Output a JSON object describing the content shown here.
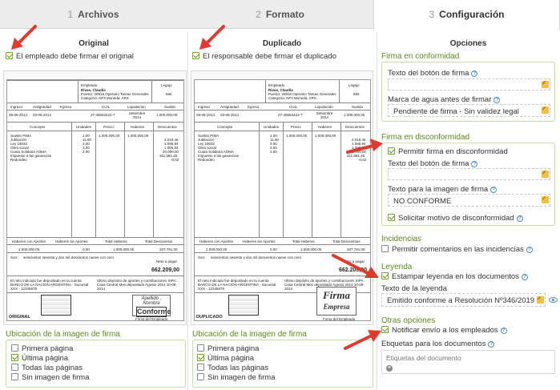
{
  "tabs": [
    {
      "num": "1",
      "label": "Archivos"
    },
    {
      "num": "2",
      "label": "Formato"
    },
    {
      "num": "3",
      "label": "Configuración"
    }
  ],
  "original": {
    "title": "Original",
    "check_label": "El empleado debe firmar el original",
    "check_on": true,
    "receipt": {
      "label": "ORIGINAL",
      "stamp_label": "Firma del Empleado",
      "sign_text": "Conforme",
      "sign_script": "Apellido , Nombre"
    }
  },
  "duplicado": {
    "title": "Duplicado",
    "check_label": "El responsable debe firmar el duplicado",
    "check_on": true,
    "receipt": {
      "label": "DUPLICADO",
      "stamp_label": "Firma del Empleado",
      "sign_text": "Firma",
      "sign_script": "Empresa"
    }
  },
  "receipt_common": {
    "empleado_label": "Empleado",
    "legajo_label": "Legajo",
    "emp_name": "Rivas, Claudia",
    "emp_line2": "Puesto: 26918 Operario Tareas Generales",
    "emp_line3": "Categoría: NF3 Moneda: ARS",
    "legajo_val": "666",
    "headers": [
      "Ingreso",
      "Antigüedad",
      "Egreso",
      "CUIL",
      "Liquidación",
      "Sueldo"
    ],
    "values": [
      "05-08-2014",
      "03-08-2014",
      "",
      "27-46653422-7",
      "Setiembre 2014",
      "1.000.000,00"
    ],
    "concept_headers": [
      "Concepto",
      "Unidades",
      "Precio",
      "Haberes",
      "Descuentos"
    ],
    "concepts": [
      [
        "Sueldo PIMA",
        "1.00",
        "1.000.000,00",
        "1.000.000,00",
        ""
      ],
      [
        "Jubilación",
        "11.00",
        "",
        "",
        "4.018,46"
      ],
      [
        "Ley 19032",
        "3.00",
        "",
        "",
        "1.095,94"
      ],
      [
        "Obra social",
        "3.00",
        "",
        "",
        "1.095,94"
      ],
      [
        "Cuota Solidaria AOMA",
        "2.00",
        "",
        "",
        "20.000,00"
      ],
      [
        "Impuesto a las ganancias",
        "",
        "",
        "",
        "311.581,45"
      ],
      [
        "Redondeo",
        "",
        "",
        "",
        "-0,62"
      ]
    ],
    "totals_headers": [
      "Haberes con Aportes",
      "Haberes sin Aportes",
      "Total Haberes",
      "Total Descuentos"
    ],
    "totals_values": [
      "1.000.000,00",
      "0,00",
      "1.000.000,00",
      "337.791,00"
    ],
    "son_label": "Son:",
    "son_text": "seiscientos sesenta y dos mil doscientos nueve con cero",
    "neto_label": "Neto a pagar",
    "neto_value": "662.209,00",
    "deposit_text": "El neto indicado fue depositado en la cuenta BANCO DE LA NACION ARGENTINA - Sucursal XXX - 12345678",
    "aportes_text": "Último depósito de aportes y contribuciones SIPA: Casa Central Mes depositado Agosto 2014 10-09-2014"
  },
  "ubicacion": {
    "title": "Ubicación de la imagen de firma",
    "options": [
      "Primera página",
      "Última página",
      "Todas las páginas",
      "Sin imagen de firma"
    ],
    "left_selected": 1,
    "right_selected": 1
  },
  "opciones": {
    "title": "Opciones",
    "firma_conformidad": {
      "title": "Firma en conformidad",
      "texto_boton_label": "Texto del botón de firma",
      "texto_boton_value": "",
      "marca_agua_label": "Marca de agua antes de firmar",
      "marca_agua_value": "Pendiente de firma - Sin validez legal"
    },
    "firma_disconformidad": {
      "title": "Firma en disconformidad",
      "permitir_label": "Permitir firma en disconformidad",
      "texto_boton_label": "Texto del botón de firma",
      "texto_boton_value": "",
      "texto_imagen_label": "Texto para la imagen de firma",
      "texto_imagen_value": "NO CONFORME",
      "solicitar_label": "Solicitar motivo de disconformidad"
    },
    "incidencias": {
      "title": "Incidencias",
      "permitir_label": "Permitir comentarios en las incidencias"
    },
    "leyenda": {
      "title": "Leyenda",
      "estampar_label": "Estampar leyenda en los documentos",
      "texto_label": "Texto de la leyenda",
      "texto_value": "Emitido conforme a Resolución Nº346/2019 ..."
    },
    "otras": {
      "title": "Otras opciones",
      "notificar_label": "Notificar envío a los empleados",
      "etiquetas_label": "Etiquetas para los documentos",
      "etiquetas_placeholder": "Etiquetas del documento"
    }
  },
  "colors": {
    "green_title": "#5a8a1e",
    "green_border": "#c8dca8",
    "arrow_red": "#e03a2f",
    "help_blue": "#4a8ad0"
  }
}
